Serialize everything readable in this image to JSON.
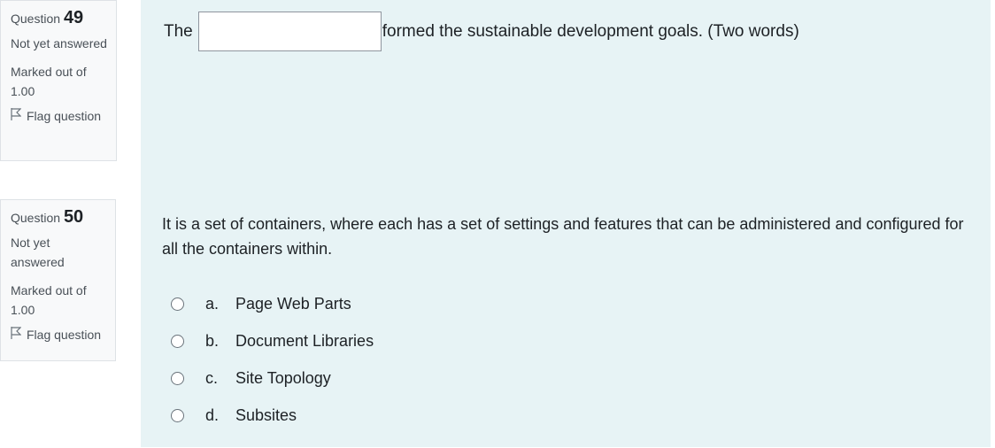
{
  "questions": [
    {
      "label": "Question",
      "number": "49",
      "state": "Not yet answered",
      "grade": "Marked out of 1.00",
      "flag_label": "Flag question",
      "text_before": "The",
      "blank_value": "",
      "text_after": "formed the sustainable development goals. (Two words)"
    },
    {
      "label": "Question",
      "number": "50",
      "state": "Not yet answered",
      "grade": "Marked out of 1.00",
      "flag_label": "Flag question",
      "text": "It is a set of containers, where each has a set of settings and features that can be administered and configured for all the containers within.",
      "options": [
        {
          "letter": "a.",
          "label": "Page Web Parts"
        },
        {
          "letter": "b.",
          "label": "Document Libraries"
        },
        {
          "letter": "c.",
          "label": "Site Topology"
        },
        {
          "letter": "d.",
          "label": "Subsites"
        }
      ]
    }
  ],
  "icons": {
    "flag": "flag-icon",
    "radio": "radio-unchecked"
  },
  "colors": {
    "content_bg": "#e7f3f5",
    "info_bg": "#f8f9fa",
    "border": "#dee2e6"
  }
}
